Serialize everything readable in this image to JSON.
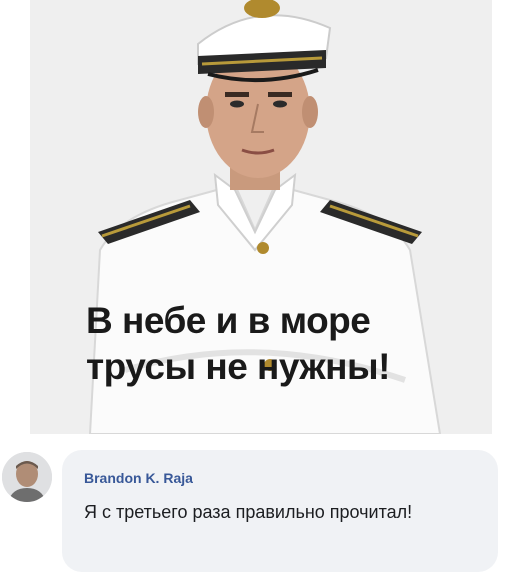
{
  "post": {
    "image_subject": "sailor-portrait",
    "caption_line1": "В небе и в море",
    "caption_line2": "трусы не нужны!"
  },
  "comment": {
    "author": "Brandon K. Raja",
    "text": "Я с третьего раза правильно прочитал!"
  },
  "colors": {
    "author_link": "#385898",
    "bubble_bg": "#f0f2f5"
  }
}
